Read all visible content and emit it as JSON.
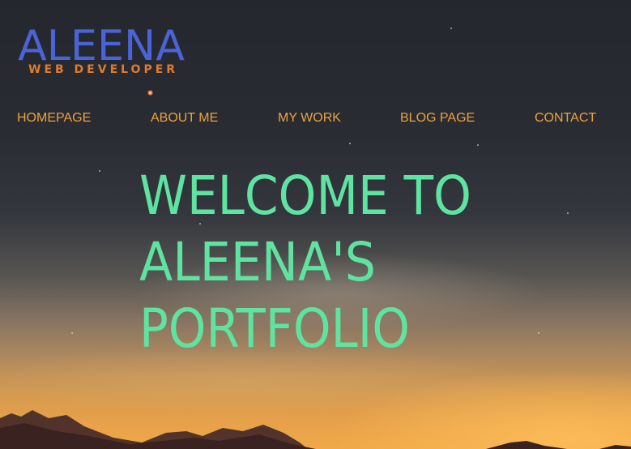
{
  "logo": {
    "name": "ALEENA",
    "subtitle": "WEB DEVELOPER"
  },
  "nav": {
    "items": [
      {
        "label": "HOMEPAGE"
      },
      {
        "label": "ABOUT ME"
      },
      {
        "label": "MY WORK"
      },
      {
        "label": "BLOG PAGE"
      },
      {
        "label": "CONTACT"
      }
    ]
  },
  "hero": {
    "lines": [
      "WELCOME TO",
      "ALEENA'S",
      "PORTFOLIO"
    ]
  },
  "colors": {
    "logo_name": "#4b63d8",
    "logo_subtitle": "#e07b2e",
    "nav_text": "#eaa23f",
    "hero_text": "#5fe3a0"
  }
}
